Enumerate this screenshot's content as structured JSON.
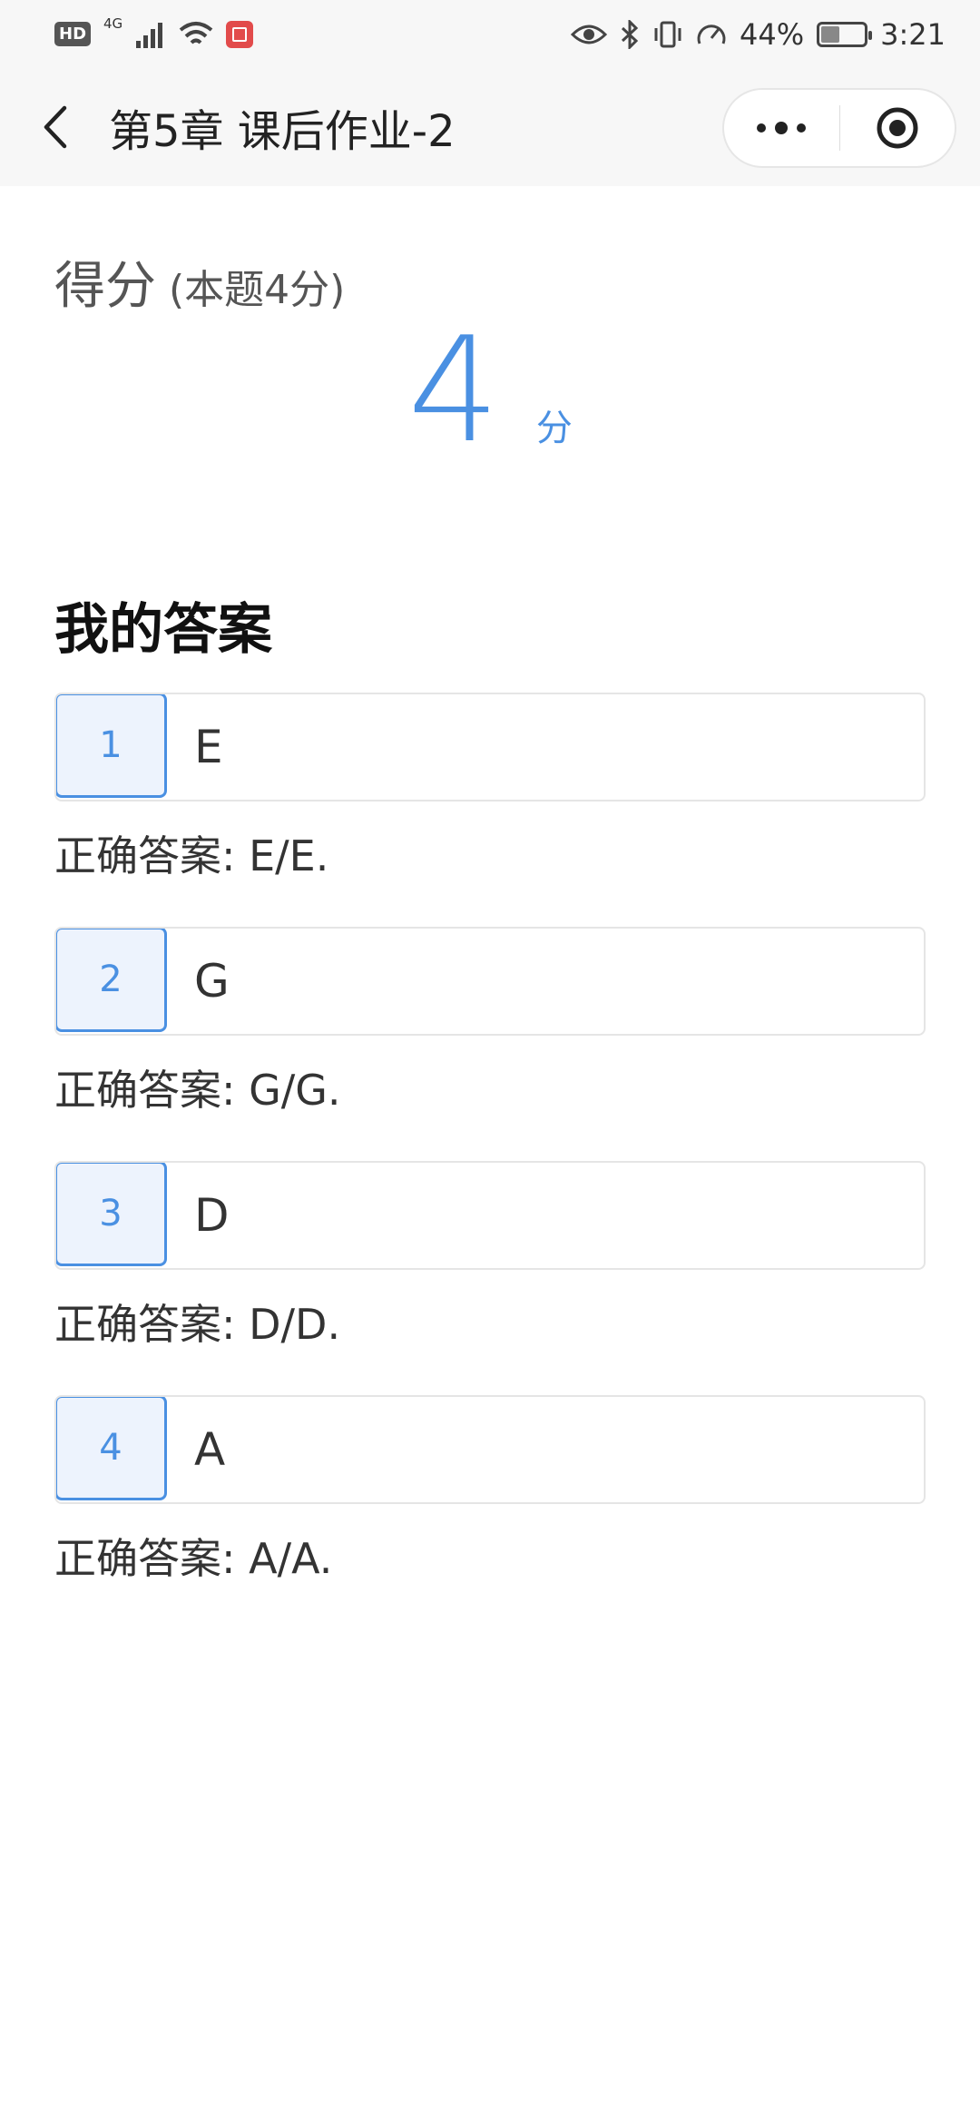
{
  "status_bar": {
    "hd": "HD",
    "network": "4G",
    "battery_percent": "44%",
    "battery_level": 0.44,
    "time": "3:21"
  },
  "nav": {
    "title": "第5章 课后作业-2"
  },
  "score": {
    "title": "得分",
    "note": "(本题4分)",
    "value": "4",
    "unit": "分"
  },
  "answers": {
    "section_title": "我的答案",
    "items": [
      {
        "number": "1",
        "value": "E",
        "correct": "正确答案: E/E."
      },
      {
        "number": "2",
        "value": "G",
        "correct": "正确答案: G/G."
      },
      {
        "number": "3",
        "value": "D",
        "correct": "正确答案: D/D."
      },
      {
        "number": "4",
        "value": "A",
        "correct": "正确答案: A/A."
      }
    ]
  },
  "colors": {
    "accent": "#4a90e2",
    "number_bg": "#edf3fd"
  }
}
